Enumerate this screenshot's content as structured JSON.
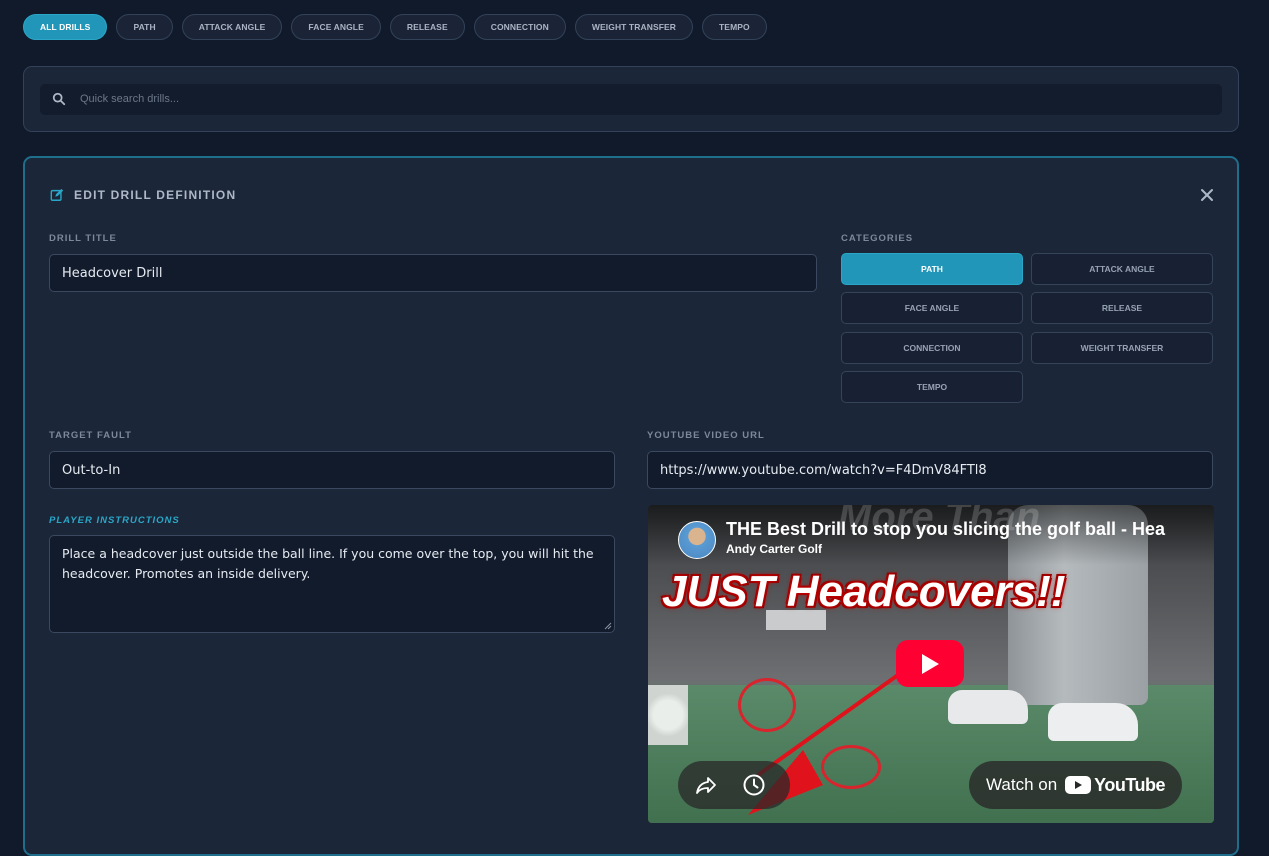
{
  "filters": [
    "ALL DRILLS",
    "PATH",
    "ATTACK ANGLE",
    "FACE ANGLE",
    "RELEASE",
    "CONNECTION",
    "WEIGHT TRANSFER",
    "TEMPO"
  ],
  "active_filter": "ALL DRILLS",
  "search": {
    "placeholder": "Quick search drills..."
  },
  "edit": {
    "title": "EDIT DRILL DEFINITION",
    "drill_title_label": "DRILL TITLE",
    "drill_title_value": "Headcover Drill",
    "categories_label": "CATEGORIES",
    "categories": [
      {
        "label": "PATH",
        "selected": true
      },
      {
        "label": "ATTACK ANGLE",
        "selected": false
      },
      {
        "label": "FACE ANGLE",
        "selected": false
      },
      {
        "label": "RELEASE",
        "selected": false
      },
      {
        "label": "CONNECTION",
        "selected": false
      },
      {
        "label": "WEIGHT TRANSFER",
        "selected": false
      },
      {
        "label": "TEMPO",
        "selected": false
      }
    ],
    "target_fault_label": "TARGET FAULT",
    "target_fault_value": "Out-to-In",
    "youtube_label": "YOUTUBE VIDEO URL",
    "youtube_value": "https://www.youtube.com/watch?v=F4DmV84FTl8",
    "instructions_label": "PLAYER INSTRUCTIONS",
    "instructions_value": "Place a headcover just outside the ball line. If you come over the top, you will hit the headcover. Promotes an inside delivery."
  },
  "video": {
    "title": "THE Best Drill to stop you slicing the golf ball - Hea",
    "channel": "Andy Carter Golf",
    "background_text": "More Than",
    "headline": "JUST Headcovers!!",
    "watch_on": "Watch on",
    "youtube_brand": "YouTube"
  },
  "colors": {
    "accent": "#2196b8",
    "background": "#101a2b",
    "panel": "#1b2638",
    "youtube_red": "#ff0033"
  }
}
